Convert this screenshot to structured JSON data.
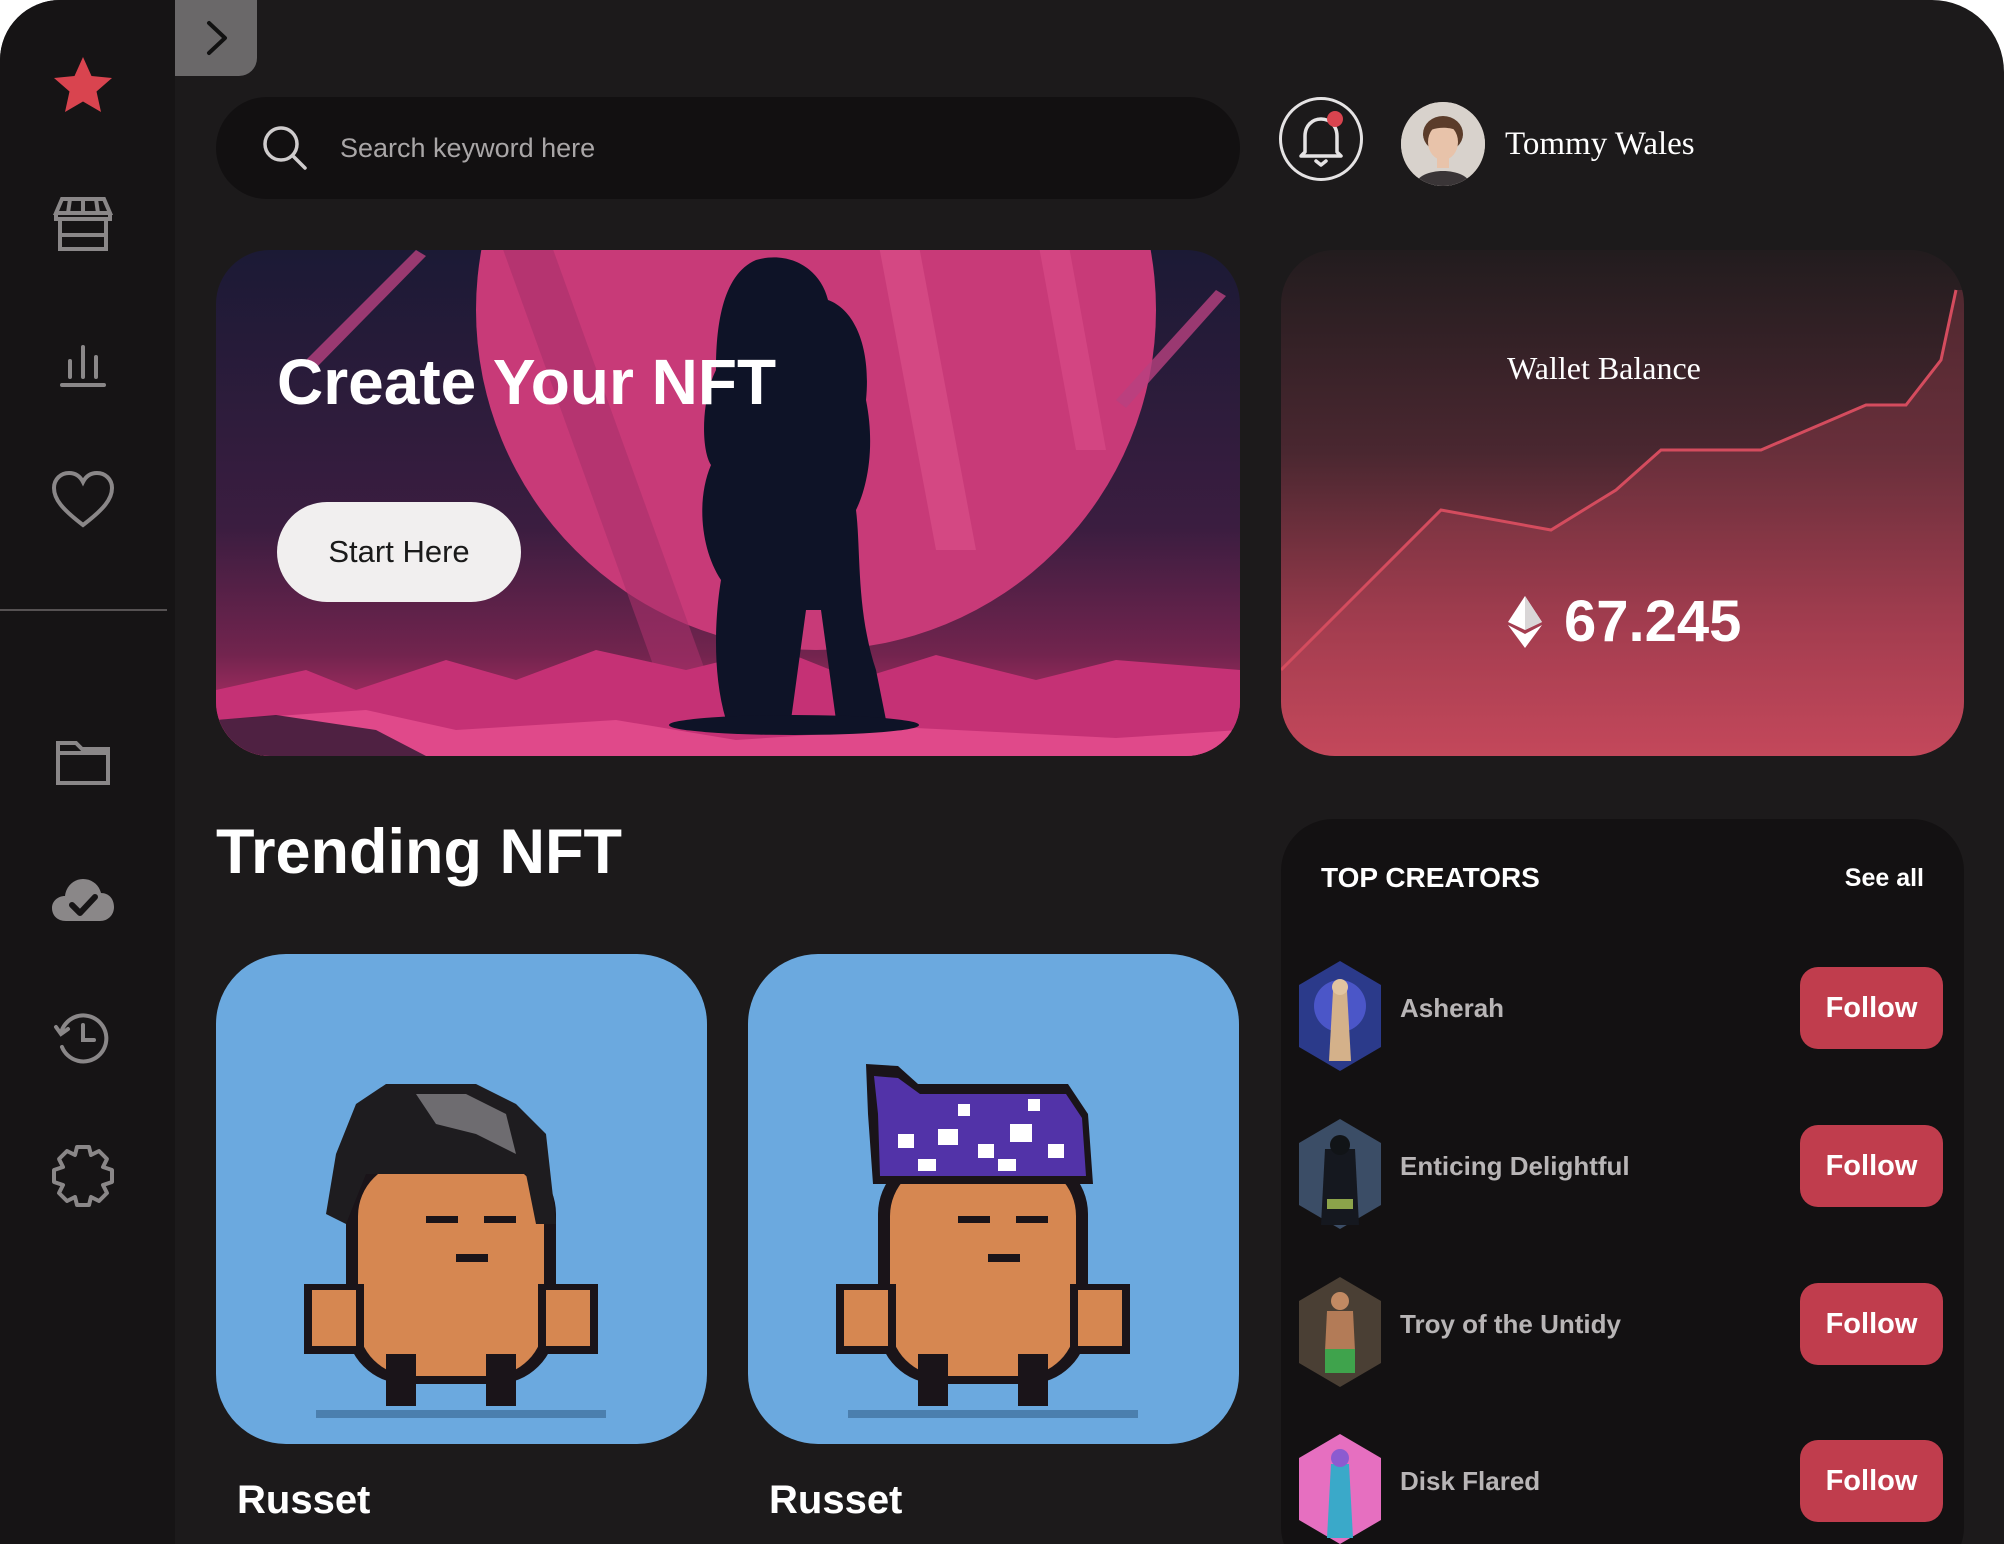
{
  "search": {
    "placeholder": "Search keyword here"
  },
  "user": {
    "name": "Tommy Wales"
  },
  "banner": {
    "title": "Create Your NFT",
    "button_label": "Start Here"
  },
  "wallet": {
    "title": "Wallet Balance",
    "amount": "67.245",
    "currency_icon": "ethereum-icon"
  },
  "trending": {
    "title": "Trending NFT",
    "items": [
      {
        "name": "Russet"
      },
      {
        "name": "Russet"
      }
    ]
  },
  "top_creators": {
    "title": "TOP CREATORS",
    "see_all": "See all",
    "items": [
      {
        "name": "Asherah",
        "follow_label": "Follow"
      },
      {
        "name": "Enticing Delightful",
        "follow_label": "Follow"
      },
      {
        "name": "Troy of the Untidy",
        "follow_label": "Follow"
      },
      {
        "name": "Disk Flared",
        "follow_label": "Follow"
      }
    ]
  },
  "sidebar": {
    "icons": [
      "star-icon",
      "store-icon",
      "chart-icon",
      "heart-icon",
      "folder-icon",
      "cloud-check-icon",
      "history-icon",
      "settings-icon"
    ]
  },
  "colors": {
    "accent": "#c03d4d",
    "background": "#1c1a1b",
    "sidebar": "#161415",
    "active": "#d9444f"
  }
}
